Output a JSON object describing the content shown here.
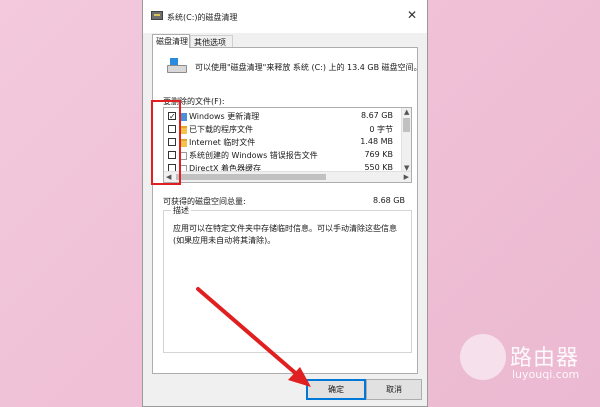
{
  "window": {
    "title": "系统(C:)的磁盘清理",
    "close_glyph": "✕"
  },
  "tabs": [
    {
      "label": "磁盘清理"
    },
    {
      "label": "其他选项"
    }
  ],
  "intro_text": "可以使用\"磁盘清理\"来释放 系统 (C:) 上的 13.4 GB 磁盘空间。",
  "files_label": "要删除的文件(F):",
  "files": [
    {
      "name": "Windows 更新清理",
      "size": "8.67 GB",
      "checked": "✓",
      "icon": "blue-file-icon"
    },
    {
      "name": "已下载的程序文件",
      "size": "0 字节",
      "checked": "",
      "icon": "folder-icon"
    },
    {
      "name": "Internet 临时文件",
      "size": "1.48 MB",
      "checked": "",
      "icon": "folder-icon"
    },
    {
      "name": "系统创建的 Windows 错误报告文件",
      "size": "769 KB",
      "checked": "",
      "icon": "blank-file-icon"
    },
    {
      "name": "DirectX 着色器缓存",
      "size": "550 KB",
      "checked": "",
      "icon": "blank-file-icon"
    }
  ],
  "total": {
    "label": "可获得的磁盘空间总量:",
    "value": "8.68 GB"
  },
  "description": {
    "title": "描述",
    "text": "应用可以在特定文件夹中存储临时信息。可以手动清除这些信息(如果应用未自动将其清除)。"
  },
  "buttons": {
    "ok": "确定",
    "cancel": "取消"
  },
  "watermark": {
    "name": "路由器",
    "url": "luyouqi.com"
  },
  "colors": {
    "highlight": "#e02020",
    "arrow": "#e02020",
    "accent": "#0078d7"
  }
}
